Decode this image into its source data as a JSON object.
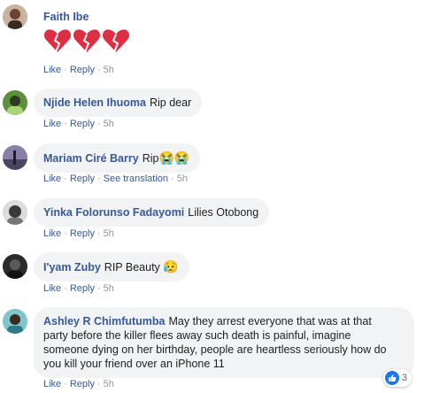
{
  "colors": {
    "link": "#385898",
    "bubble": "#f2f3f5",
    "meta": "#90949c",
    "like_blue": "#1877f2"
  },
  "action_labels": {
    "like": "Like",
    "reply": "Reply",
    "see_translation": "See translation",
    "separator": "·"
  },
  "comments": [
    {
      "author": "Faith Ibe",
      "text": "",
      "emoji": "broken-heart-icon x3",
      "time": "5h"
    },
    {
      "author": "Njide Helen Ihuoma",
      "text": "Rip dear",
      "time": "5h"
    },
    {
      "author": "Mariam Ciré Barry",
      "text": "Rip",
      "emoji": "😭😭",
      "time": "5h"
    },
    {
      "author": "Yinka Folorunso Fadayomi",
      "text": "Lilies Otobong",
      "time": "5h"
    },
    {
      "author": "I'yam Zuby",
      "text": "RIP Beauty",
      "emoji": "😥",
      "time": "5h"
    },
    {
      "author": "Ashley R Chimfutumba",
      "text_lines": [
        "May they arrest everyone that was at that",
        "party before the killer flees away such death is painful, imagine",
        "someone dying on her birthday, people are heartless seriously how do",
        "you kill your friend over an iPhone 11"
      ],
      "time": "5h",
      "reactions": {
        "icon": "like-icon",
        "count": "3"
      }
    }
  ]
}
